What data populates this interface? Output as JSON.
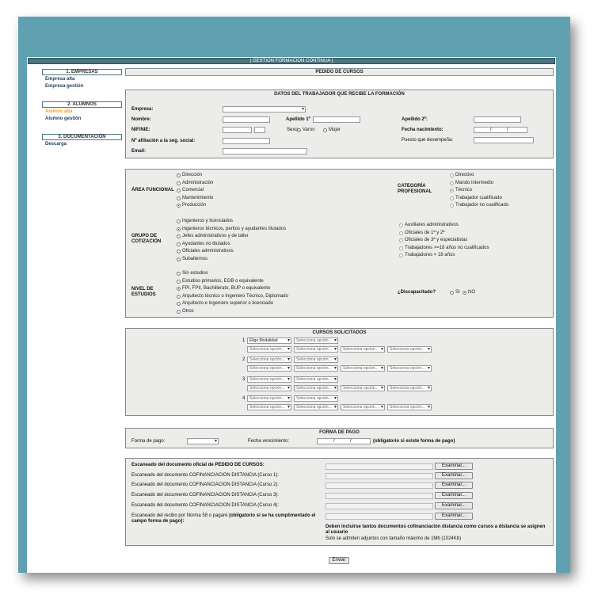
{
  "app_title": "| GESTIÓN FORMACIÓN CONTINUA |",
  "sidebar": {
    "s1": "1. EMPRESAS",
    "s1_items": [
      "Empresa alta",
      "Empresa gestión"
    ],
    "s2": "2. ALUMNOS",
    "s2_items": [
      "Alumno alta",
      "Alumno gestión"
    ],
    "s3": "3. DOCUMENTACIÓN",
    "s3_items": [
      "Descarga"
    ]
  },
  "main_title": "PEDIDO DE CURSOS",
  "datos": {
    "title": "DATOS DEL TRABAJADOR QUE RECIBE LA FORMACIÓN",
    "empresa": "Empresa:",
    "nombre": "Nombre:",
    "apellido1": "Apellido 1º",
    "apellido2": "Apellido 2º:",
    "nif": "NIF/NIE:",
    "sexo": "Sexo:",
    "varon": "Varon",
    "mujer": "Mujer",
    "fecha_nac": "Fecha nacimiento:",
    "afiliacion": "Nº afiliación a la seg. social:",
    "puesto": "Puesto que desempeña:",
    "email": "Email:"
  },
  "area": {
    "label": "ÁREA FUNCIONAL",
    "options": [
      "Dirección",
      "Administración",
      "Comercial",
      "Mantenimiento",
      "Producción"
    ],
    "selected": 4
  },
  "categoria": {
    "label1": "CATEGORÍA",
    "label2": "PROFESIONAL",
    "options": [
      "Directivo",
      "Mando intermedio",
      "Técnico",
      "Trabajador cualificado",
      "Trabajador no cualificado"
    ],
    "selected": 2
  },
  "grupo": {
    "label1": "GRUPO DE",
    "label2": "COTIZACIÓN",
    "options": [
      "Ingenieros y licenciados",
      "Ingenieros técnicos, peritos y ayudantes titulados",
      "Jefes administrativos y de taller",
      "Ayudantes no titulados",
      "Oficiales administrativos",
      "Subalternos"
    ],
    "selected": 1
  },
  "grupo2": {
    "options": [
      "Auxiliares administrativos",
      "Oficiales de 1ª y 2ª",
      "Oficiales de 3ª y especialistas",
      "Trabajadores >=18 años no cualificados",
      "Trabajadores < 18 años"
    ]
  },
  "estudios": {
    "label1": "NIVEL DE",
    "label2": "ESTUDIOS",
    "options": [
      "Sin estudios",
      "Estudios primarios, EGB o equivalente",
      "FPI, FPII, Bachillerato, BUP o equivalente",
      "Arquitecto técnico o Ingeniero Técnico, Diplomado",
      "Arquitecto e ingeniero superior o licenciado",
      "Otros"
    ],
    "selected": 2
  },
  "discapacitado": {
    "label": "¿Discapacitado?",
    "si": "SI",
    "no": "NO"
  },
  "cursos": {
    "title": "CURSOS SOLICITADOS",
    "elige": "Elige Modalidad",
    "placeholder": "Selecciona opción...",
    "numbers": [
      "1",
      "2",
      "3",
      "4"
    ]
  },
  "pago": {
    "title": "FORMA DE PAGO",
    "forma": "Forma de pago:",
    "fecha": "Fecha vencimiento:",
    "nota": "(obligatorio si existe forma de pago)"
  },
  "docs": {
    "d0": "Escaneado del documento oficial de PEDIDO DE CURSOS:",
    "d1": "Escaneado del documento COFINANCIACION DISTANCIA (Curso 1):",
    "d2": "Escaneado del documento COFINANCIACION DISTANCIA (Curso 2):",
    "d3": "Escaneado del documento COFINANCIACION DISTANCIA (Curso 3):",
    "d4": "Escaneado del documento COFINANCIACION DISTANCIA (Curso 4):",
    "d5a": "Escaneado del recibo por Norma 58 o pagaré ",
    "d5b": "(obligatorio si se ha cumplimentado el",
    "d5c": "campo forma de pago):",
    "browse": "Examinar...",
    "note1": "Deben incluirse tantos documentos cofinanciación distancia como cursos a distancia se asignen",
    "note2": "al usuario",
    "note3": "Solo se admiten adjuntos con tamaño máximo de 1Mb (1024Kb)"
  },
  "enviar": "Enviar"
}
